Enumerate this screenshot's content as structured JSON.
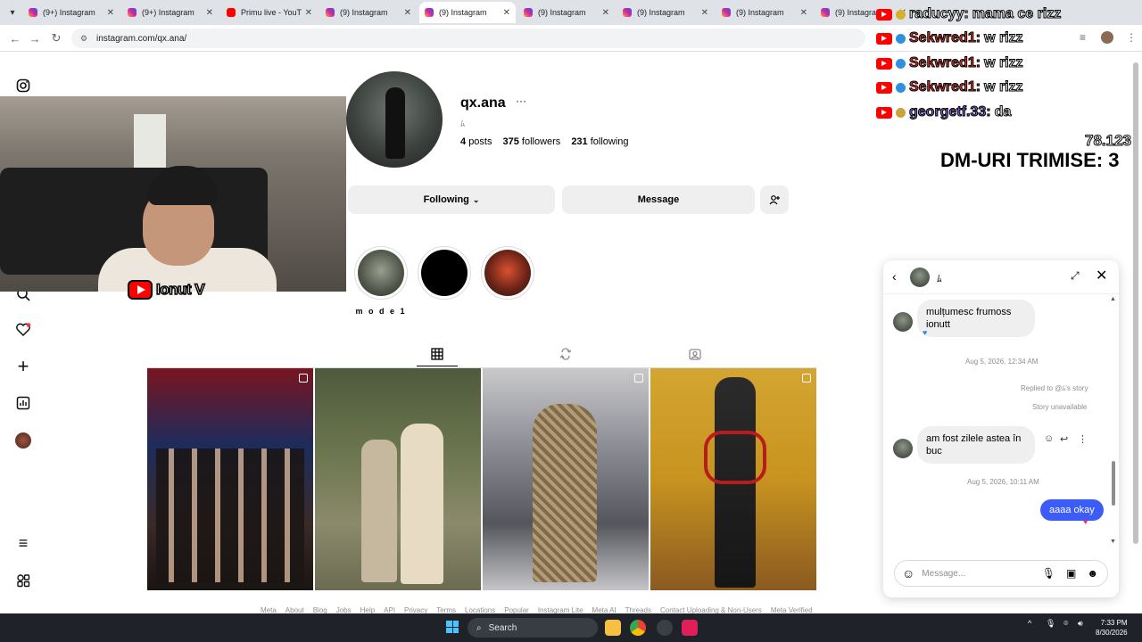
{
  "browser": {
    "tabs": [
      {
        "label": "(9+) Instagram",
        "favicon": "instagram-icon",
        "active": false
      },
      {
        "label": "(9+) Instagram",
        "favicon": "instagram-icon",
        "active": false
      },
      {
        "label": "Primu live - YouTu",
        "favicon": "youtube-icon",
        "active": false
      },
      {
        "label": "(9) Instagram",
        "favicon": "instagram-icon",
        "active": false
      },
      {
        "label": "(9) Instagram",
        "favicon": "instagram-icon",
        "active": true
      },
      {
        "label": "(9) Instagram",
        "favicon": "instagram-icon",
        "active": false
      },
      {
        "label": "(9) Instagram",
        "favicon": "instagram-icon",
        "active": false
      },
      {
        "label": "(9) Instagram",
        "favicon": "instagram-icon",
        "active": false
      },
      {
        "label": "(9) Instagram",
        "favicon": "instagram-icon",
        "active": false
      }
    ],
    "url": "instagram.com/qx.ana/"
  },
  "profile": {
    "username": "qx.ana",
    "pronoun": "ﾑ",
    "posts_count": "4",
    "posts_label": "posts",
    "followers_count": "375",
    "followers_label": "followers",
    "following_count": "231",
    "following_label": "following",
    "following_button": "Following",
    "message_button": "Message",
    "highlight_label": "m o d e 1"
  },
  "footer": [
    "Meta",
    "About",
    "Blog",
    "Jobs",
    "Help",
    "API",
    "Privacy",
    "Terms",
    "Locations",
    "Popular",
    "Instagram Lite",
    "Meta AI",
    "Threads",
    "Contact Uploading & Non-Users",
    "Meta Verified"
  ],
  "stream": {
    "webcam_name": "Ionut V",
    "chat": [
      {
        "author": "raducyy:",
        "message": "mama ce rizz",
        "author_color": "#ffffff",
        "mark_color": "#d6b12a"
      },
      {
        "author": "Sekwred1:",
        "message": "w rizz",
        "author_color": "#e0392b",
        "mark_color": "#2f8fe0"
      },
      {
        "author": "Sekwred1:",
        "message": "w rizz",
        "author_color": "#e0392b",
        "mark_color": "#2f8fe0"
      },
      {
        "author": "Sekwred1:",
        "message": "w rizz",
        "author_color": "#e0392b",
        "mark_color": "#2f8fe0"
      },
      {
        "author": "georgetf.33:",
        "message": "da",
        "author_color": "#7b5fc9",
        "mark_color": "#c9a33a"
      }
    ],
    "counter": "78.123",
    "dm_counter": "DM-URI TRIMISE: 3"
  },
  "dm": {
    "contact": "ﾑ",
    "messages": [
      {
        "type": "in",
        "text_line1": "mulțumesc frumoss",
        "text_line2": "ionutt"
      },
      {
        "type": "time",
        "text": "Aug 5, 2026, 12:34 AM"
      },
      {
        "type": "note",
        "text": "Replied to @ﾑ's story"
      },
      {
        "type": "note",
        "text": "Story unavailable"
      },
      {
        "type": "in",
        "text_line1": "am fost zilele astea în",
        "text_line2": "buc"
      },
      {
        "type": "time",
        "text": "Aug 5, 2026, 10:11 AM"
      },
      {
        "type": "out",
        "text": "aaaa okay"
      }
    ],
    "input_placeholder": "Message..."
  },
  "taskbar": {
    "search_placeholder": "Search",
    "time": "7:33 PM",
    "date": "8/30/2026"
  },
  "colors": {
    "instagram_blue": "#3b5cf6",
    "youtube_red": "#ff0000",
    "taskbar_bg": "#1f2228"
  }
}
